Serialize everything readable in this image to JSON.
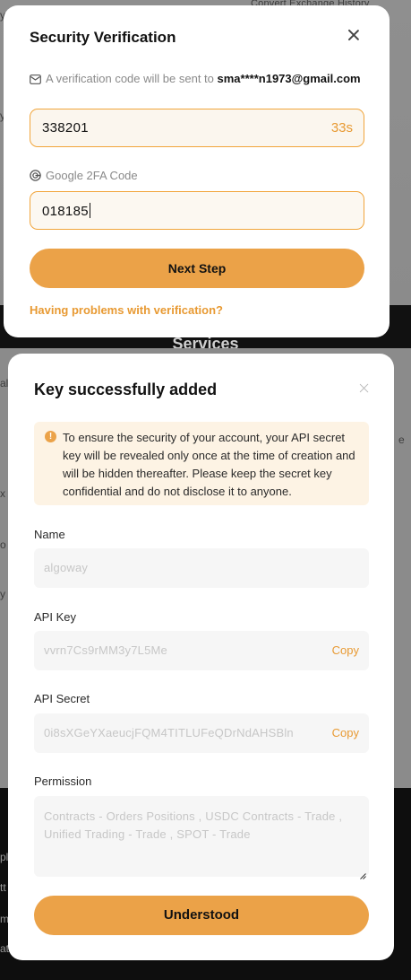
{
  "background": {
    "tabs": "Convert   Exchange History",
    "section_title": "Services",
    "side_scraps": [
      "y",
      "y",
      "all",
      "x",
      "e",
      "o",
      "y",
      "pl",
      "tt",
      "m",
      "at"
    ]
  },
  "verification_modal": {
    "title": "Security Verification",
    "notice_prefix": "A verification code will be sent to",
    "email": "sma****n1973@gmail.com",
    "email_code": "338201",
    "countdown": "33s",
    "google_label": "Google 2FA Code",
    "google_code": "018185",
    "next_button": "Next Step",
    "help_link": "Having problems with verification?"
  },
  "key_modal": {
    "title": "Key successfully added",
    "warning": "To ensure the security of your account, your API secret key will be revealed only once at the time of creation and will be hidden thereafter. Please keep the secret key confidential and do not disclose it to anyone.",
    "name_label": "Name",
    "name_value": "algoway",
    "api_key_label": "API Key",
    "api_key_value": "vvrn7Cs9rMM3y7L5Me",
    "api_secret_label": "API Secret",
    "api_secret_value": "0i8sXGeYXaeucjFQM4TITLUFeQDrNdAHSBln",
    "copy_label": "Copy",
    "permission_label": "Permission",
    "permission_value": "Contracts - Orders Positions , USDC Contracts - Trade , Unified Trading - Trade , SPOT - Trade",
    "understood_button": "Understood"
  },
  "colors": {
    "accent": "#eba248",
    "accent_text": "#e89a33",
    "warning_bg": "#fdf3e4",
    "overlay": "#8b8b8b"
  },
  "icons": {
    "mail": "mail-icon",
    "google": "google-icon",
    "warning": "warning-icon",
    "close": "close-icon"
  }
}
